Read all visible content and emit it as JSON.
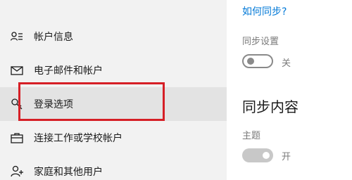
{
  "nav": {
    "items": [
      {
        "label": "帐户信息",
        "icon": "user-info-icon"
      },
      {
        "label": "电子邮件和帐户",
        "icon": "mail-icon"
      },
      {
        "label": "登录选项",
        "icon": "key-icon",
        "selected": true
      },
      {
        "label": "连接工作或学校帐户",
        "icon": "briefcase-icon"
      },
      {
        "label": "家庭和其他用户",
        "icon": "add-user-icon"
      }
    ]
  },
  "right": {
    "help_link": "如何同步?",
    "sync_settings": {
      "label": "同步设置",
      "state": "关"
    },
    "sync_content_title": "同步内容",
    "theme": {
      "label": "主题",
      "state": "开"
    }
  },
  "colors": {
    "nav_background": "#f2f2f2",
    "selected_background": "#e3e3e3",
    "highlight_border": "#d61f26",
    "link": "#0078d7"
  }
}
